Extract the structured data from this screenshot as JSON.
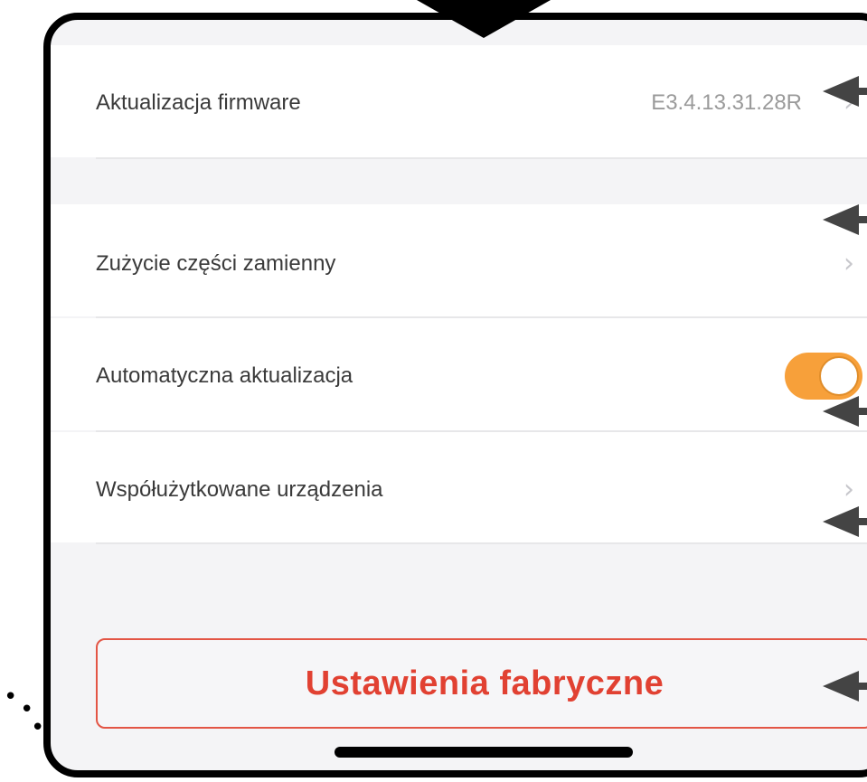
{
  "settings": {
    "firmware": {
      "label": "Aktualizacja firmware",
      "value": "E3.4.13.31.28R"
    },
    "parts": {
      "label": "Zużycie części zamienny"
    },
    "auto_update": {
      "label": "Automatyczna aktualizacja",
      "enabled": true
    },
    "shared": {
      "label": "Współużytkowane urządzenia"
    }
  },
  "reset_button": {
    "label": "Ustawienia fabryczne"
  },
  "colors": {
    "accent": "#F7A03A",
    "danger": "#E14132",
    "background": "#F4F4F6"
  },
  "icons": {
    "chevron": "chevron-right-icon",
    "pointer": "arrow-left-icon"
  }
}
